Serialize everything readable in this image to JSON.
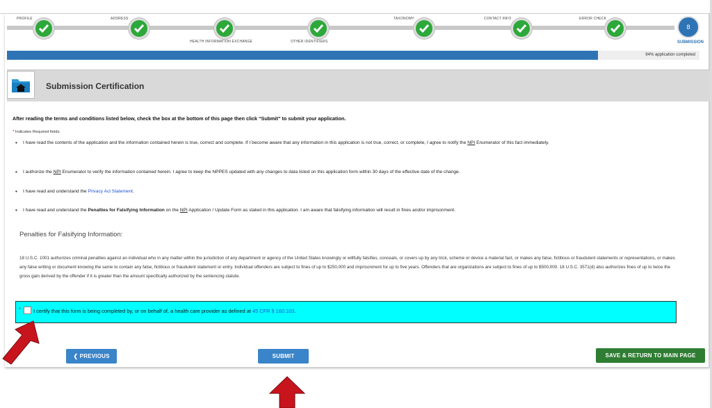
{
  "stepper": {
    "steps": [
      {
        "label": "PROFILE"
      },
      {
        "label": "ADDRESS"
      },
      {
        "label": "HEALTH INFORMATION EXCHANGE"
      },
      {
        "label": "OTHER IDENTIFIERS"
      },
      {
        "label": "TAXONOMY"
      },
      {
        "label": "CONTACT INFO"
      },
      {
        "label": "ERROR CHECK"
      }
    ],
    "final_step_number": "8",
    "final_step_label": "SUBMISSION"
  },
  "progress": {
    "percent": 94,
    "text": "94% application completed"
  },
  "header": {
    "title": "Submission Certification"
  },
  "intro": "After reading the terms and conditions listed below, check the box at the bottom of this page then click “Submit” to submit your application.",
  "required_note": {
    "star": "*",
    "text": " Indicates Required fields."
  },
  "terms": {
    "item1_a": "I have read the contents of the application and the information contained herein is true, correct and complete. If I become aware that any information in this application is not true, correct, or complete, I agree to notify the ",
    "npi": "NPI",
    "item1_b": " Enumerator of this fact immediately.",
    "item2_a": "I authorize the ",
    "item2_b": " Enumerator to verify the information contained herein. I agree to keep the NPPES updated with any changes to data listed on this application form within 30 days of the effective date of the change.",
    "item3_a": "I have read and understand the ",
    "privacy_link": "Privacy Act Statement",
    "item3_b": ".",
    "item4_a": "I have read and understand the ",
    "penalties_bold": "Penalties for Falsifying Information",
    "item4_b": " on the ",
    "item4_c": " Application / Update Form as stated in this application. I am aware that falsifying information will result in fines and/or imprisonment."
  },
  "penalties": {
    "title": "Penalties for Falsifying Information:",
    "body": "18 U.S.C. 1001 authorizes criminal penalties against an individual who in any matter within the jurisdiction of any department or agency of the United States knowingly or willfully falsifies, conceals, or covers up by any trick, scheme or device a material fact, or makes any false, fictitious or fraudulent statements or representations, or makes any false writing or document knowing the same to contain any false, fictitious or fraudulent statement or entry. Individual offenders are subject to fines of up to $250,000 and imprisonment for up to five years. Offenders that are organizations are subject to fines of up to $500,000. 18 U.S.C. 3571(d) also authorizes fines of up to twice the gross gain derived by the offender if it is greater than the amount specifically authorized by the sentencing statute."
  },
  "certify": {
    "star": "*",
    "text": "I certify that this form is being completed by, or on behalf of, a health care provider as defined at ",
    "link": "45 CFR § 160.103",
    "end": "."
  },
  "buttons": {
    "previous": "❮ PREVIOUS",
    "submit": "SUBMIT",
    "save": "SAVE & RETURN TO MAIN PAGE"
  },
  "colors": {
    "step_done": "#2da83a",
    "accent_blue": "#2e74b5",
    "cert_highlight": "#00ffff",
    "save_green": "#2e7d32",
    "arrow_red": "#c8141c"
  }
}
